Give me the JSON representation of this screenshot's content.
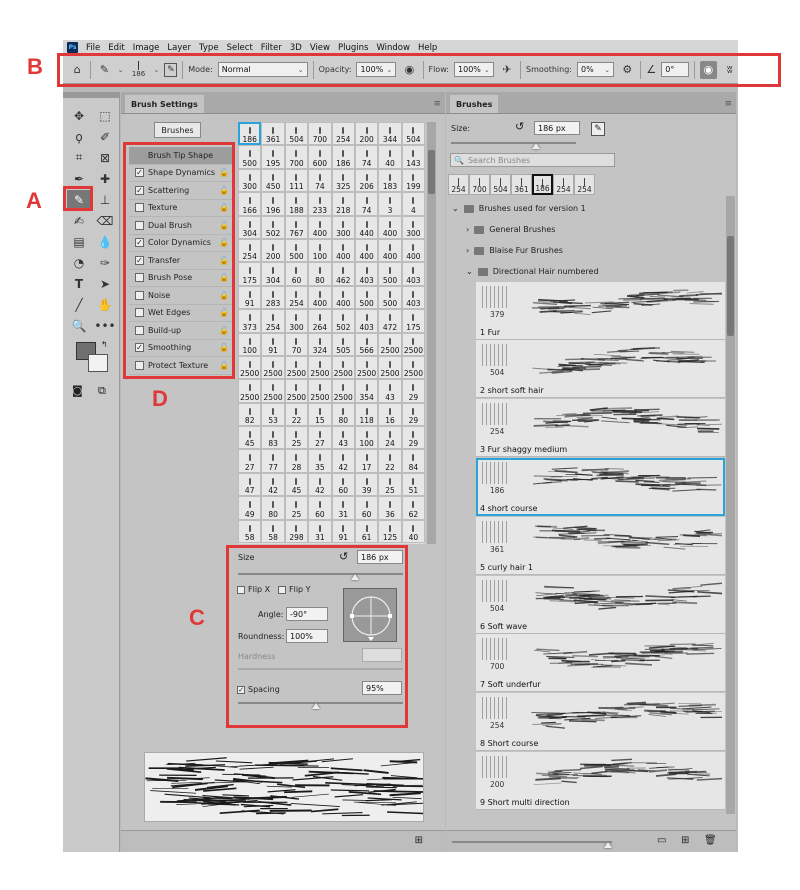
{
  "app": {
    "logo": "Ps"
  },
  "menu": [
    "File",
    "Edit",
    "Image",
    "Layer",
    "Type",
    "Select",
    "Filter",
    "3D",
    "View",
    "Plugins",
    "Window",
    "Help"
  ],
  "options": {
    "brush_size": "186",
    "mode_label": "Mode:",
    "mode_value": "Normal",
    "opacity_label": "Opacity:",
    "opacity_value": "100%",
    "flow_label": "Flow:",
    "flow_value": "100%",
    "smoothing_label": "Smoothing:",
    "smoothing_value": "0%",
    "angle_value": "0°"
  },
  "markers": {
    "a": "A",
    "b": "B",
    "c": "C",
    "d": "D"
  },
  "brush_settings": {
    "tab": "Brush Settings",
    "brushes_button": "Brushes",
    "options": [
      {
        "label": "Brush Tip Shape",
        "checked": null
      },
      {
        "label": "Shape Dynamics",
        "checked": true
      },
      {
        "label": "Scattering",
        "checked": true
      },
      {
        "label": "Texture",
        "checked": false
      },
      {
        "label": "Dual Brush",
        "checked": false
      },
      {
        "label": "Color Dynamics",
        "checked": true
      },
      {
        "label": "Transfer",
        "checked": true
      },
      {
        "label": "Brush Pose",
        "checked": false
      },
      {
        "label": "Noise",
        "checked": false
      },
      {
        "label": "Wet Edges",
        "checked": false
      },
      {
        "label": "Build-up",
        "checked": false
      },
      {
        "label": "Smoothing",
        "checked": true
      },
      {
        "label": "Protect Texture",
        "checked": false
      }
    ],
    "tips": [
      "186",
      "361",
      "504",
      "700",
      "254",
      "200",
      "344",
      "504",
      "500",
      "195",
      "700",
      "600",
      "186",
      "74",
      "40",
      "143",
      "300",
      "450",
      "111",
      "74",
      "325",
      "206",
      "183",
      "199",
      "166",
      "196",
      "188",
      "233",
      "218",
      "74",
      "3",
      "4",
      "304",
      "502",
      "767",
      "400",
      "300",
      "440",
      "400",
      "300",
      "254",
      "200",
      "500",
      "100",
      "400",
      "400",
      "400",
      "400",
      "175",
      "304",
      "60",
      "80",
      "462",
      "403",
      "500",
      "403",
      "91",
      "283",
      "254",
      "400",
      "400",
      "500",
      "500",
      "403",
      "373",
      "254",
      "300",
      "264",
      "502",
      "403",
      "472",
      "175",
      "100",
      "91",
      "70",
      "324",
      "505",
      "566",
      "2500",
      "2500",
      "2500",
      "2500",
      "2500",
      "2500",
      "2500",
      "2500",
      "2500",
      "2500",
      "2500",
      "2500",
      "2500",
      "2500",
      "2500",
      "354",
      "43",
      "29",
      "82",
      "53",
      "22",
      "15",
      "80",
      "118",
      "16",
      "29",
      "45",
      "83",
      "25",
      "27",
      "43",
      "100",
      "24",
      "29",
      "27",
      "77",
      "28",
      "35",
      "42",
      "17",
      "22",
      "84",
      "47",
      "42",
      "45",
      "42",
      "60",
      "39",
      "25",
      "51",
      "49",
      "80",
      "25",
      "60",
      "31",
      "60",
      "36",
      "62",
      "58",
      "58",
      "298",
      "31",
      "91",
      "61",
      "125",
      "40"
    ],
    "size_label": "Size",
    "size_value": "186 px",
    "flip_x": "Flip X",
    "flip_y": "Flip Y",
    "angle_label": "Angle:",
    "angle_value": "-90°",
    "roundness_label": "Roundness:",
    "roundness_value": "100%",
    "hardness_label": "Hardness",
    "spacing_label": "Spacing",
    "spacing_value": "95%"
  },
  "brushes_panel": {
    "tab": "Brushes",
    "size_label": "Size:",
    "size_value": "186 px",
    "search_placeholder": "Search Brushes",
    "recent": [
      "254",
      "700",
      "504",
      "361",
      "186",
      "254",
      "254"
    ],
    "folders": [
      {
        "label": "Brushes used for version 1"
      },
      {
        "label": "General Brushes"
      },
      {
        "label": "Blaise Fur Brushes"
      },
      {
        "label": "Directional Hair numbered"
      }
    ],
    "items": [
      {
        "size": "379",
        "name": "1 Fur"
      },
      {
        "size": "504",
        "name": "2 short soft hair"
      },
      {
        "size": "254",
        "name": "3 Fur shaggy medium"
      },
      {
        "size": "186",
        "name": "4 short course"
      },
      {
        "size": "361",
        "name": "5 curly hair 1"
      },
      {
        "size": "504",
        "name": "6 Soft wave"
      },
      {
        "size": "700",
        "name": "7 Soft underfur"
      },
      {
        "size": "254",
        "name": "8 Short course"
      },
      {
        "size": "200",
        "name": "9 Short multi direction"
      }
    ]
  }
}
